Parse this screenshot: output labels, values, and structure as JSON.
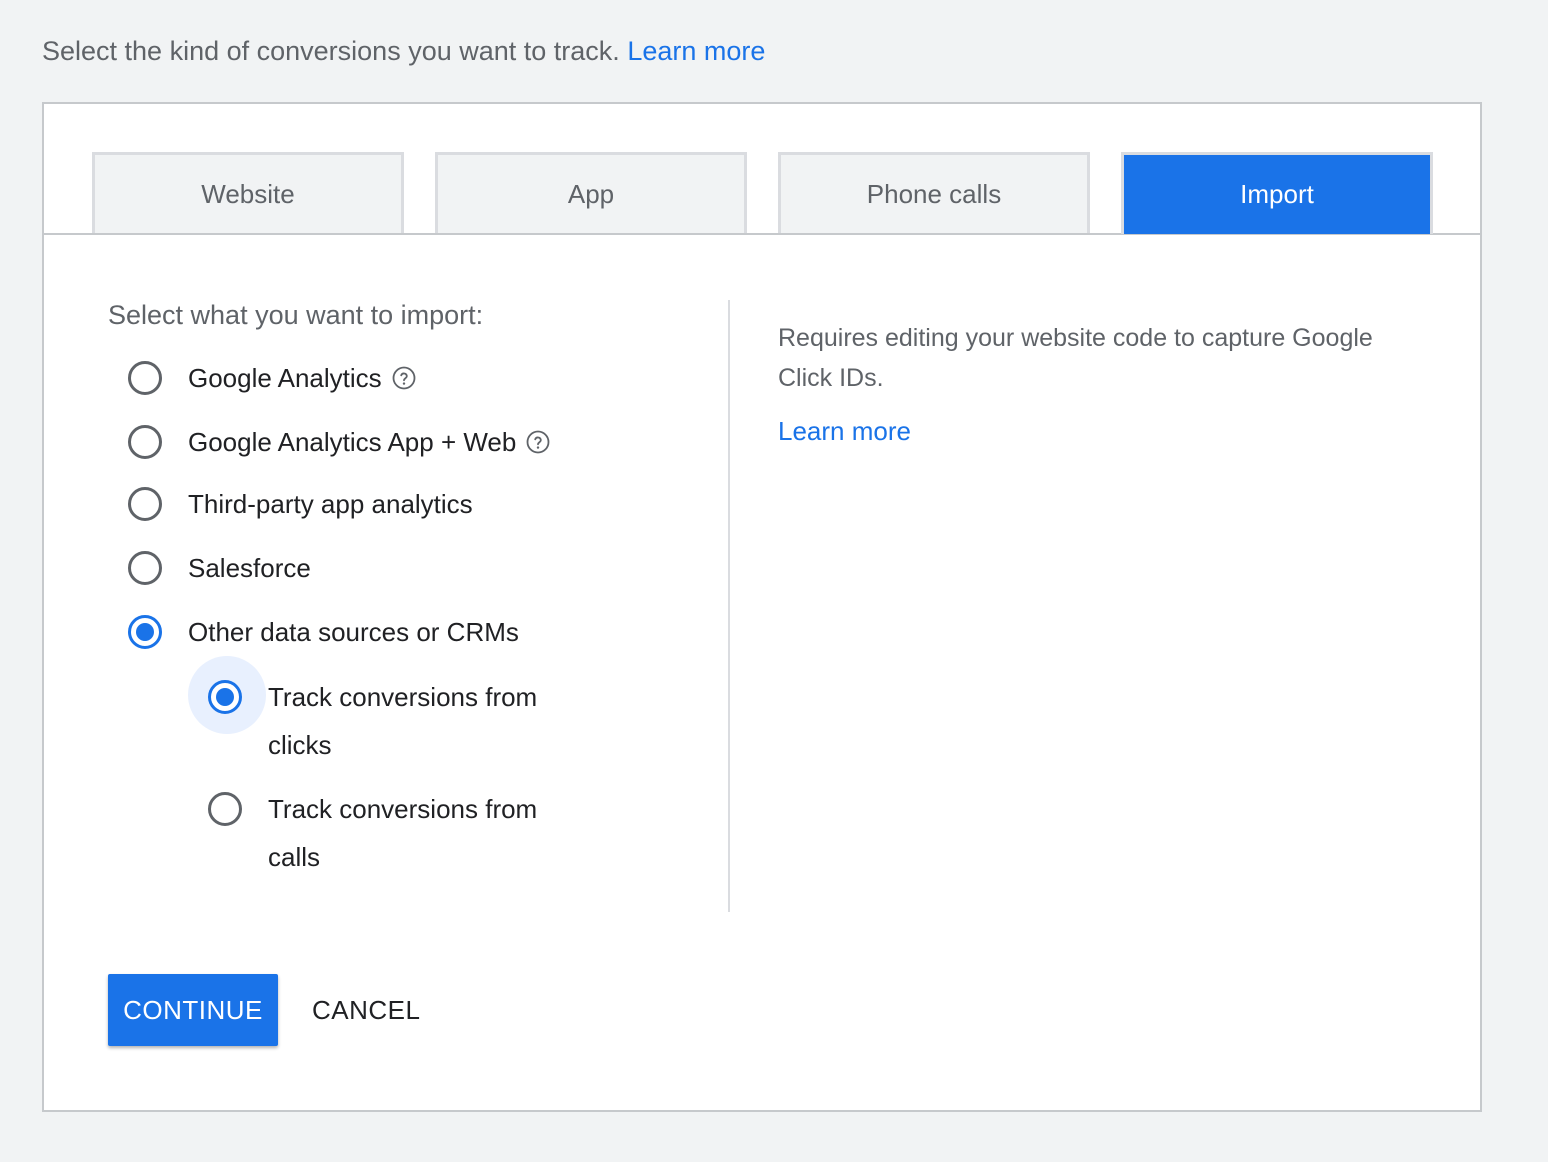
{
  "intro": {
    "text": "Select the kind of conversions you want to track.",
    "link": "Learn more"
  },
  "tabs": [
    {
      "label": "Website",
      "active": false
    },
    {
      "label": "App",
      "active": false
    },
    {
      "label": "Phone calls",
      "active": false
    },
    {
      "label": "Import",
      "active": true
    }
  ],
  "import": {
    "prompt": "Select what you want to import:",
    "options": [
      {
        "label": "Google Analytics",
        "checked": false,
        "help_icon": "help-circle-icon"
      },
      {
        "label": "Google Analytics App + Web",
        "checked": false,
        "help_icon": "help-circle-icon"
      },
      {
        "label": "Third-party app analytics",
        "checked": false
      },
      {
        "label": "Salesforce",
        "checked": false
      },
      {
        "label": "Other data sources or CRMs",
        "checked": true
      }
    ],
    "sub_options": [
      {
        "label": "Track conversions from clicks",
        "checked": true
      },
      {
        "label": "Track conversions from calls",
        "checked": false
      }
    ]
  },
  "description": {
    "text": "Requires editing your website code to capture Google Click IDs.",
    "link": "Learn more"
  },
  "actions": {
    "continue_label": "CONTINUE",
    "cancel_label": "CANCEL"
  },
  "colors": {
    "accent": "#1a73e8",
    "background": "#f1f3f4",
    "muted_text": "#5f6368"
  }
}
